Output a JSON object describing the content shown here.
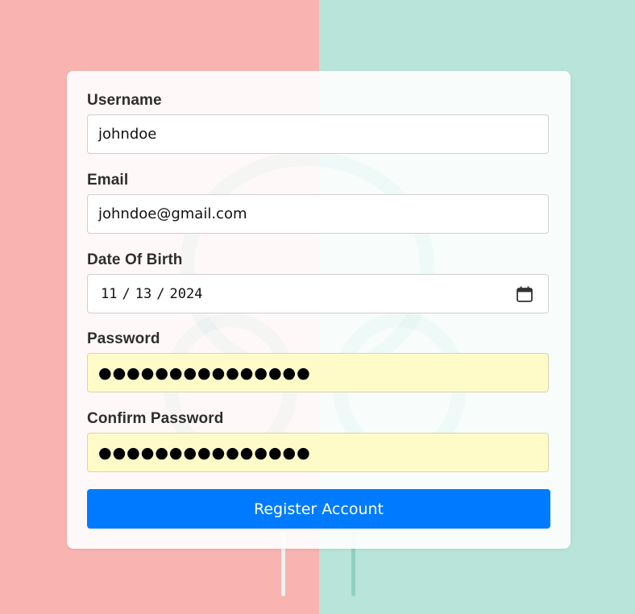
{
  "form": {
    "username": {
      "label": "Username",
      "value": "johndoe"
    },
    "email": {
      "label": "Email",
      "value": "johndoe@gmail.com"
    },
    "dob": {
      "label": "Date Of Birth",
      "month": "11",
      "day": "13",
      "year": "2024",
      "separator": "/"
    },
    "password": {
      "label": "Password",
      "masked": "●●●●●●●●●●●●●●●",
      "autofill_color": "#fefbc8"
    },
    "confirm_password": {
      "label": "Confirm Password",
      "masked": "●●●●●●●●●●●●●●●"
    },
    "submit_label": "Register Account",
    "submit_color": "#007bff"
  },
  "background": {
    "left_color": "#f9b4b2",
    "right_color": "#b9e4d9"
  },
  "icons": {
    "calendar": "calendar-icon"
  }
}
